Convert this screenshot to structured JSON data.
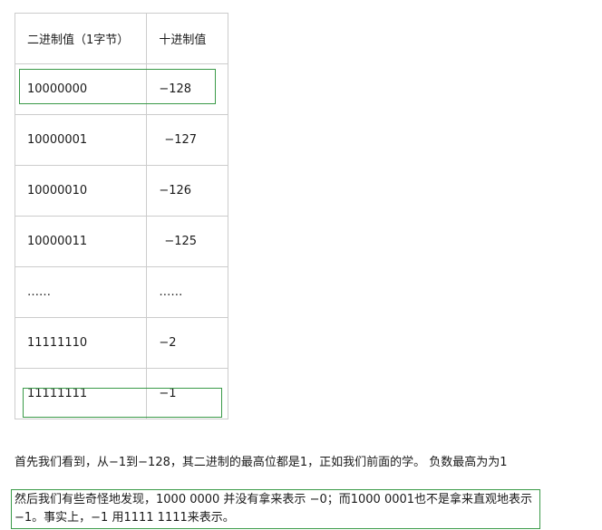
{
  "table": {
    "headers": [
      "二进制值（1字节）",
      "十进制值"
    ],
    "rows": [
      [
        "10000000",
        "−128"
      ],
      [
        "10000001",
        "−127"
      ],
      [
        "10000010",
        "−126"
      ],
      [
        "10000011",
        "−125"
      ],
      [
        "……",
        "……"
      ],
      [
        "11111110",
        "−2"
      ],
      [
        "11111111",
        "−1"
      ]
    ]
  },
  "paragraphs": {
    "p1": "首先我们看到，从−1到−128，其二进制的最高位都是1，正如我们前面的学。 负数最高为为1",
    "p2": "然后我们有些奇怪地发现，1000 0000 并没有拿来表示 −0；而1000 0001也不是拿来直观地表示−1。事实上，−1 用1111 1111来表示。"
  },
  "colors": {
    "highlight_border": "#3a9a48",
    "table_border": "#cccccc"
  }
}
